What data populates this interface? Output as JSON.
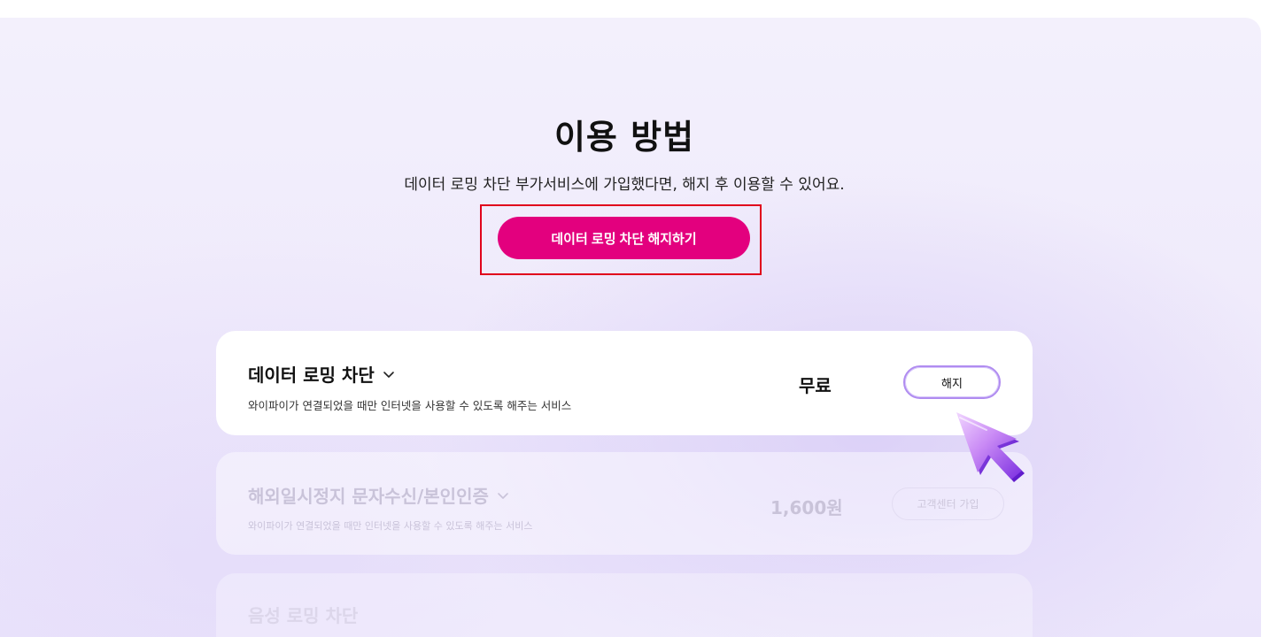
{
  "heading": {
    "title": "이용 방법",
    "subtitle": "데이터 로밍 차단 부가서비스에 가입했다면, 해지 후 이용할 수 있어요."
  },
  "cta": {
    "label": "데이터 로밍 차단 해지하기",
    "color": "#e3007e",
    "highlight_color": "#e0001b"
  },
  "services": [
    {
      "name": "데이터 로밍 차단",
      "description": "와이파이가 연결되었을 때만 인터넷을 사용할 수 있도록 해주는 서비스",
      "price": "무료",
      "action_label": "해지"
    },
    {
      "name": "해외일시정지 문자수신/본인인증",
      "description": "와이파이가 연결되었을 때만 인터넷을 사용할 수 있도록 해주는 서비스",
      "price": "1,600원",
      "action_label": "고객센터 가입"
    },
    {
      "name": "음성 로밍 차단"
    }
  ],
  "icons": {
    "chevron": "chevron-down-icon",
    "pointer": "pointer-cursor-icon"
  }
}
